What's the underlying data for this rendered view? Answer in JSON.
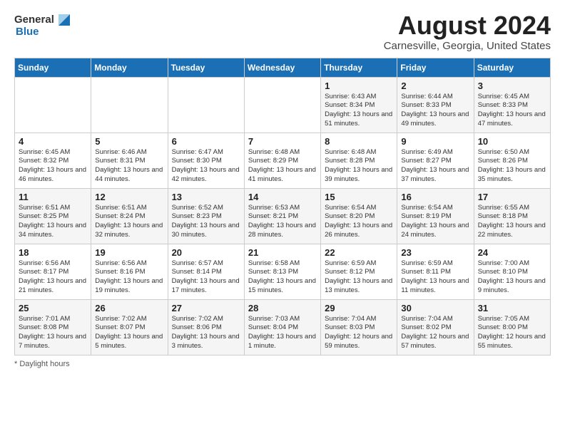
{
  "logo": {
    "general": "General",
    "blue": "Blue"
  },
  "title": "August 2024",
  "subtitle": "Carnesville, Georgia, United States",
  "days_of_week": [
    "Sunday",
    "Monday",
    "Tuesday",
    "Wednesday",
    "Thursday",
    "Friday",
    "Saturday"
  ],
  "footer": "Daylight hours",
  "weeks": [
    [
      {
        "day": "",
        "info": ""
      },
      {
        "day": "",
        "info": ""
      },
      {
        "day": "",
        "info": ""
      },
      {
        "day": "",
        "info": ""
      },
      {
        "day": "1",
        "info": "Sunrise: 6:43 AM\nSunset: 8:34 PM\nDaylight: 13 hours and 51 minutes."
      },
      {
        "day": "2",
        "info": "Sunrise: 6:44 AM\nSunset: 8:33 PM\nDaylight: 13 hours and 49 minutes."
      },
      {
        "day": "3",
        "info": "Sunrise: 6:45 AM\nSunset: 8:33 PM\nDaylight: 13 hours and 47 minutes."
      }
    ],
    [
      {
        "day": "4",
        "info": "Sunrise: 6:45 AM\nSunset: 8:32 PM\nDaylight: 13 hours and 46 minutes."
      },
      {
        "day": "5",
        "info": "Sunrise: 6:46 AM\nSunset: 8:31 PM\nDaylight: 13 hours and 44 minutes."
      },
      {
        "day": "6",
        "info": "Sunrise: 6:47 AM\nSunset: 8:30 PM\nDaylight: 13 hours and 42 minutes."
      },
      {
        "day": "7",
        "info": "Sunrise: 6:48 AM\nSunset: 8:29 PM\nDaylight: 13 hours and 41 minutes."
      },
      {
        "day": "8",
        "info": "Sunrise: 6:48 AM\nSunset: 8:28 PM\nDaylight: 13 hours and 39 minutes."
      },
      {
        "day": "9",
        "info": "Sunrise: 6:49 AM\nSunset: 8:27 PM\nDaylight: 13 hours and 37 minutes."
      },
      {
        "day": "10",
        "info": "Sunrise: 6:50 AM\nSunset: 8:26 PM\nDaylight: 13 hours and 35 minutes."
      }
    ],
    [
      {
        "day": "11",
        "info": "Sunrise: 6:51 AM\nSunset: 8:25 PM\nDaylight: 13 hours and 34 minutes."
      },
      {
        "day": "12",
        "info": "Sunrise: 6:51 AM\nSunset: 8:24 PM\nDaylight: 13 hours and 32 minutes."
      },
      {
        "day": "13",
        "info": "Sunrise: 6:52 AM\nSunset: 8:23 PM\nDaylight: 13 hours and 30 minutes."
      },
      {
        "day": "14",
        "info": "Sunrise: 6:53 AM\nSunset: 8:21 PM\nDaylight: 13 hours and 28 minutes."
      },
      {
        "day": "15",
        "info": "Sunrise: 6:54 AM\nSunset: 8:20 PM\nDaylight: 13 hours and 26 minutes."
      },
      {
        "day": "16",
        "info": "Sunrise: 6:54 AM\nSunset: 8:19 PM\nDaylight: 13 hours and 24 minutes."
      },
      {
        "day": "17",
        "info": "Sunrise: 6:55 AM\nSunset: 8:18 PM\nDaylight: 13 hours and 22 minutes."
      }
    ],
    [
      {
        "day": "18",
        "info": "Sunrise: 6:56 AM\nSunset: 8:17 PM\nDaylight: 13 hours and 21 minutes."
      },
      {
        "day": "19",
        "info": "Sunrise: 6:56 AM\nSunset: 8:16 PM\nDaylight: 13 hours and 19 minutes."
      },
      {
        "day": "20",
        "info": "Sunrise: 6:57 AM\nSunset: 8:14 PM\nDaylight: 13 hours and 17 minutes."
      },
      {
        "day": "21",
        "info": "Sunrise: 6:58 AM\nSunset: 8:13 PM\nDaylight: 13 hours and 15 minutes."
      },
      {
        "day": "22",
        "info": "Sunrise: 6:59 AM\nSunset: 8:12 PM\nDaylight: 13 hours and 13 minutes."
      },
      {
        "day": "23",
        "info": "Sunrise: 6:59 AM\nSunset: 8:11 PM\nDaylight: 13 hours and 11 minutes."
      },
      {
        "day": "24",
        "info": "Sunrise: 7:00 AM\nSunset: 8:10 PM\nDaylight: 13 hours and 9 minutes."
      }
    ],
    [
      {
        "day": "25",
        "info": "Sunrise: 7:01 AM\nSunset: 8:08 PM\nDaylight: 13 hours and 7 minutes."
      },
      {
        "day": "26",
        "info": "Sunrise: 7:02 AM\nSunset: 8:07 PM\nDaylight: 13 hours and 5 minutes."
      },
      {
        "day": "27",
        "info": "Sunrise: 7:02 AM\nSunset: 8:06 PM\nDaylight: 13 hours and 3 minutes."
      },
      {
        "day": "28",
        "info": "Sunrise: 7:03 AM\nSunset: 8:04 PM\nDaylight: 13 hours and 1 minute."
      },
      {
        "day": "29",
        "info": "Sunrise: 7:04 AM\nSunset: 8:03 PM\nDaylight: 12 hours and 59 minutes."
      },
      {
        "day": "30",
        "info": "Sunrise: 7:04 AM\nSunset: 8:02 PM\nDaylight: 12 hours and 57 minutes."
      },
      {
        "day": "31",
        "info": "Sunrise: 7:05 AM\nSunset: 8:00 PM\nDaylight: 12 hours and 55 minutes."
      }
    ]
  ]
}
